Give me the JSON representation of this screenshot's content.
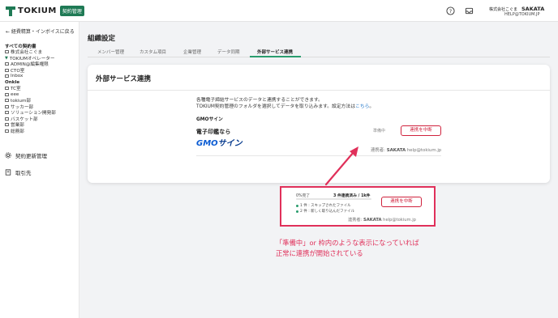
{
  "header": {
    "logo_text": "TOKIUM",
    "logo_badge": "契約管理",
    "company": "株式会社こぐま",
    "username": "SAKATA",
    "email": "HELP@TOKIUM.JP",
    "icons": [
      "help-icon",
      "inbox-icon"
    ]
  },
  "sidebar": {
    "back_link": "← 経費精算・インボイスに戻る",
    "tree": [
      {
        "label": "すべての契約書",
        "bold": true,
        "icon": "none"
      },
      {
        "label": "株式会社こぐま",
        "bold": false,
        "icon": "folder"
      },
      {
        "label": "TOKIUMオペレーター",
        "bold": false,
        "icon": "filter"
      },
      {
        "label": "ADMIN@編集権限",
        "bold": false,
        "icon": "folder"
      },
      {
        "label": "CTO室",
        "bold": false,
        "icon": "folder"
      },
      {
        "label": "Inbox",
        "bold": false,
        "icon": "folder"
      },
      {
        "label": "Onkle",
        "bold": true,
        "icon": "none"
      },
      {
        "label": "TC室",
        "bold": false,
        "icon": "folder"
      },
      {
        "label": "eee",
        "bold": false,
        "icon": "folder"
      },
      {
        "label": "tokium部",
        "bold": false,
        "icon": "folder"
      },
      {
        "label": "サッカー部",
        "bold": false,
        "icon": "folder"
      },
      {
        "label": "ソリューション開発部",
        "bold": false,
        "icon": "folder"
      },
      {
        "label": "バスケット部",
        "bold": false,
        "icon": "folder"
      },
      {
        "label": "営業部",
        "bold": false,
        "icon": "folder"
      },
      {
        "label": "総務部",
        "bold": false,
        "icon": "folder"
      }
    ],
    "menu": [
      {
        "label": "契約更新管理",
        "icon": "gear-icon"
      },
      {
        "label": "取引先",
        "icon": "building-icon"
      }
    ]
  },
  "main": {
    "title": "組織設定",
    "tabs": [
      "メンバー管理",
      "カスタム項目",
      "企業管理",
      "データ同期",
      "外部サービス連携"
    ],
    "active_tab": "外部サービス連携"
  },
  "card": {
    "title": "外部サービス連携",
    "desc_line1": "各種電子締結サービスのデータと連携することができます。",
    "desc_line2": "TOKIUM契約管理のフォルダを選択してデータを取り込みます。設定方法は",
    "desc_link": "こちら",
    "desc_end": "。",
    "service_label": "GMOサイン",
    "logo_line1": "電子印鑑なら",
    "logo_gmo": "GMO",
    "logo_sign": "サイン",
    "status": "準備中",
    "stop_button": "連携を中断",
    "owner_label": "連携者:",
    "owner_name": "SAKATA",
    "owner_email": "help@tokium.jp"
  },
  "callout": {
    "progress_label": "0%完了",
    "progress_value": 0,
    "count_strong": "3 件連携済み / 1k件",
    "items": [
      "1 件 : スキップされたファイル",
      "2 件 : 新しく取り込んだファイル"
    ],
    "stop_button": "連携を中断",
    "owner_label": "連携者:",
    "owner_name": "SAKATA",
    "owner_email": "help@tokium.jp"
  },
  "annotation": {
    "line1": "「準備中」or 枠内のような表示になっていれば",
    "line2": "正常に連携が開始されている",
    "color": "#e0305a"
  },
  "colors": {
    "brand": "#1f7a55",
    "accent_tab": "#2a9d6e",
    "danger": "#d0223d",
    "link": "#1a73c8"
  }
}
